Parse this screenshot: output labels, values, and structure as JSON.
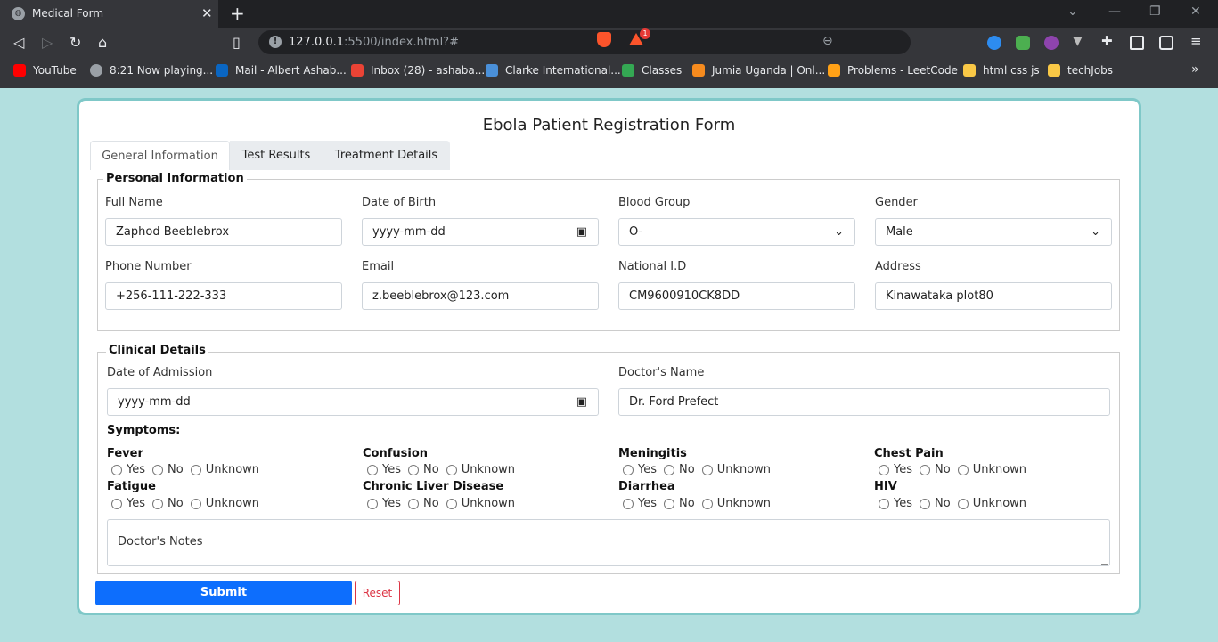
{
  "browser": {
    "tab_title": "Medical Form",
    "tab_favicon": "globe-icon",
    "url_host": "127.0.0.1",
    "url_rest": ":5500/index.html?#",
    "bookmarks": [
      {
        "label": "YouTube",
        "color": "#ff0000"
      },
      {
        "label": "8:21 Now playing...",
        "color": "#9aa0a6"
      },
      {
        "label": "Mail - Albert Ashab...",
        "color": "#0a66c2"
      },
      {
        "label": "Inbox (28) - ashaba...",
        "color": "#ea4335"
      },
      {
        "label": "Clarke International...",
        "color": "#4a90d9"
      },
      {
        "label": "Classes",
        "color": "#34a853"
      },
      {
        "label": "Jumia Uganda | Onl...",
        "color": "#f68b1e"
      },
      {
        "label": "Problems - LeetCode",
        "color": "#ffa116"
      },
      {
        "label": "html css js",
        "color": "#f9c846"
      },
      {
        "label": "techJobs",
        "color": "#f9c846"
      }
    ],
    "notification_count": "1"
  },
  "form": {
    "title": "Ebola Patient Registration Form",
    "tabs": [
      {
        "label": "General Information"
      },
      {
        "label": "Test Results"
      },
      {
        "label": "Treatment Details"
      }
    ],
    "personal": {
      "legend": "Personal Information",
      "full_name_label": "Full Name",
      "full_name_value": "Zaphod Beeblebrox",
      "dob_label": "Date of Birth",
      "dob_placeholder": "yyyy-mm-dd",
      "blood_label": "Blood Group",
      "blood_value": "O-",
      "gender_label": "Gender",
      "gender_value": "Male",
      "phone_label": "Phone Number",
      "phone_value": "+256-111-222-333",
      "email_label": "Email",
      "email_value": "z.beeblebrox@123.com",
      "nid_label": "National I.D",
      "nid_value": "CM9600910CK8DD",
      "address_label": "Address",
      "address_value": "Kinawataka plot80"
    },
    "clinical": {
      "legend": "Clinical Details",
      "admission_label": "Date of Admission",
      "admission_placeholder": "yyyy-mm-dd",
      "doctor_label": "Doctor's Name",
      "doctor_value": "Dr. Ford Prefect",
      "symptoms_title": "Symptoms:",
      "symptoms": [
        {
          "name": "Fever"
        },
        {
          "name": "Confusion"
        },
        {
          "name": "Meningitis"
        },
        {
          "name": "Chest Pain"
        },
        {
          "name": "Fatigue"
        },
        {
          "name": "Chronic Liver Disease"
        },
        {
          "name": "Diarrhea"
        },
        {
          "name": "HIV"
        }
      ],
      "options": [
        "Yes",
        "No",
        "Unknown"
      ],
      "notes_placeholder": "Doctor's Notes"
    },
    "submit_label": "Submit",
    "reset_label": "Reset"
  }
}
